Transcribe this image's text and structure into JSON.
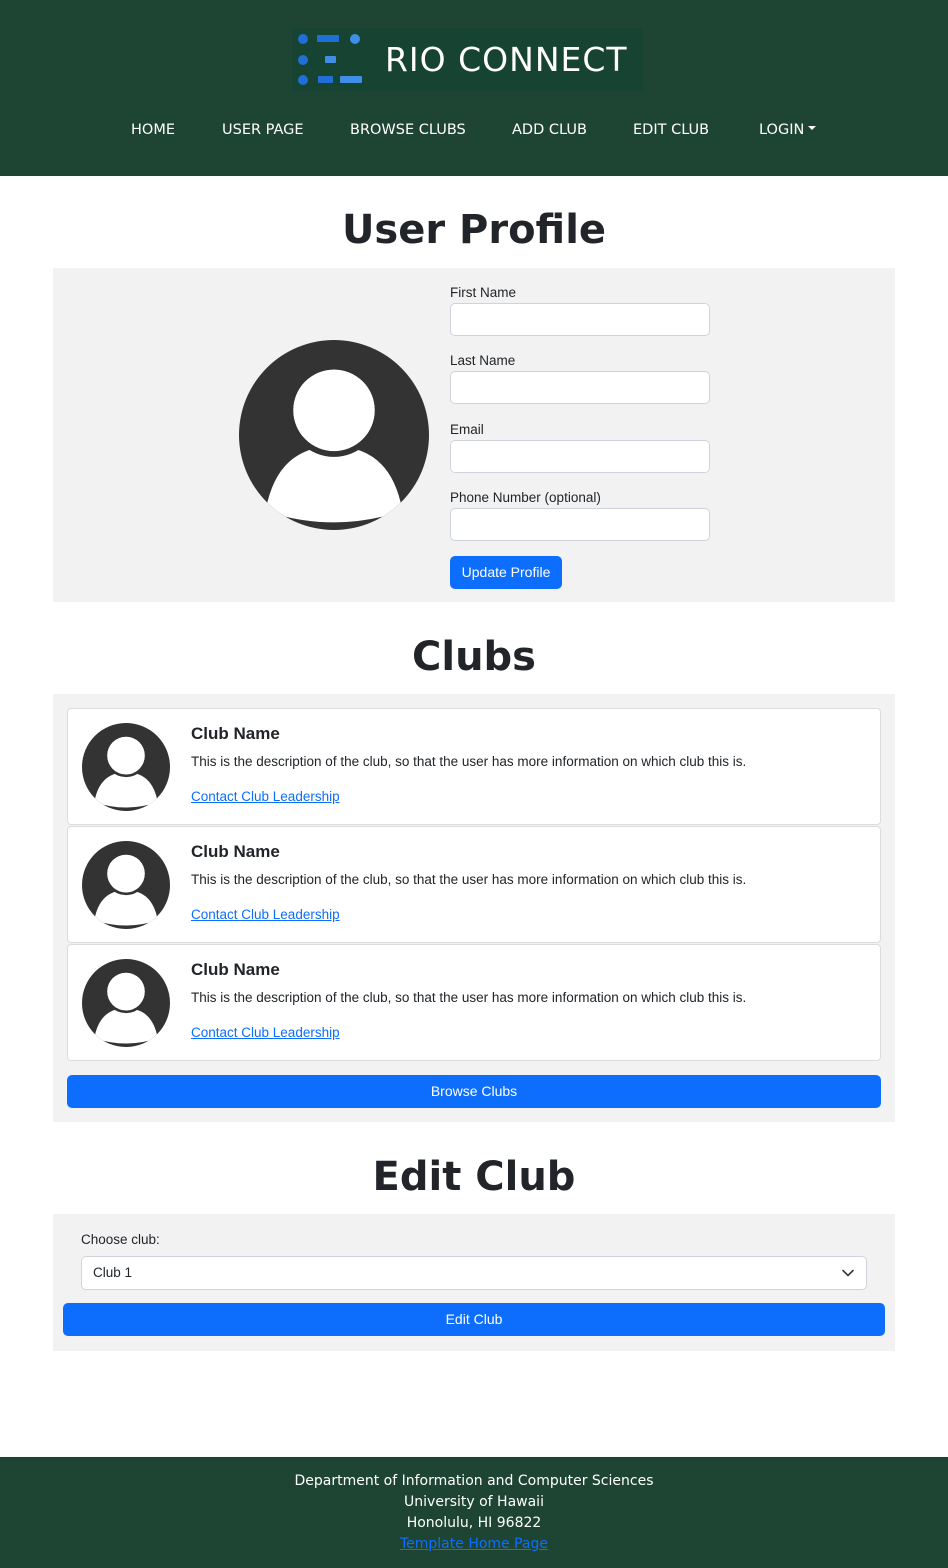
{
  "header": {
    "logo_text": "RIO CONNECT",
    "nav": [
      "HOME",
      "USER PAGE",
      "BROWSE CLUBS",
      "ADD CLUB",
      "EDIT CLUB",
      "LOGIN"
    ]
  },
  "profile": {
    "title": "User Profile",
    "avatar_icon": "user-avatar-icon",
    "fields": [
      {
        "label": "First Name",
        "value": ""
      },
      {
        "label": "Last Name",
        "value": ""
      },
      {
        "label": "Email",
        "value": ""
      },
      {
        "label": "Phone Number (optional)",
        "value": ""
      }
    ],
    "update_button": "Update Profile"
  },
  "clubs": {
    "title": "Clubs",
    "items": [
      {
        "name": "Club Name",
        "description": "This is the description of the club, so that the user has more information on which club this is.",
        "link": "Contact Club Leadership"
      },
      {
        "name": "Club Name",
        "description": "This is the description of the club, so that the user has more information on which club this is.",
        "link": "Contact Club Leadership"
      },
      {
        "name": "Club Name",
        "description": "This is the description of the club, so that the user has more information on which club this is.",
        "link": "Contact Club Leadership"
      }
    ],
    "browse_button": "Browse Clubs"
  },
  "edit_club": {
    "title": "Edit Club",
    "choose_label": "Choose club:",
    "selected": "Club 1",
    "edit_button": "Edit Club"
  },
  "footer": {
    "lines": [
      "Department of Information and Computer Sciences",
      "University of Hawaii",
      "Honolulu, HI 96822"
    ],
    "link": "Template Home Page"
  },
  "colors": {
    "header_bg": "#1e4534",
    "primary": "#0d6efd",
    "panel_bg": "#f2f2f2",
    "avatar": "#333333"
  }
}
